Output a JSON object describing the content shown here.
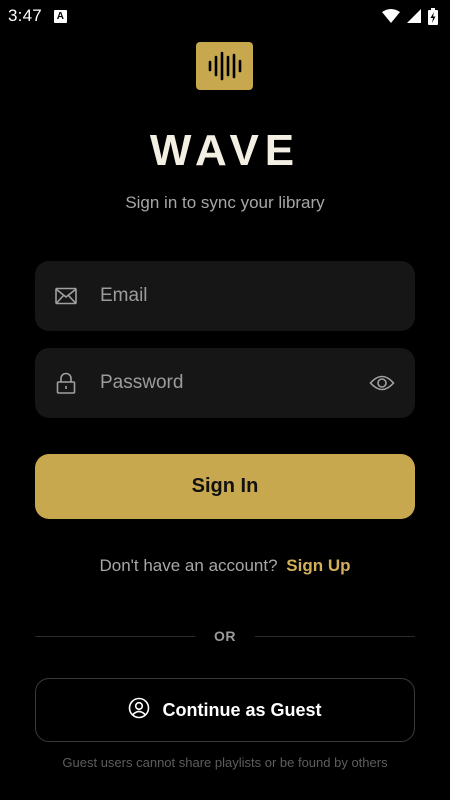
{
  "status_bar": {
    "time": "3:47",
    "notification_letter": "A",
    "icons": [
      "wifi-icon",
      "signal-icon",
      "battery-charging-icon"
    ]
  },
  "brand": {
    "logo_icon": "sound-wave-icon",
    "name": "WAVE",
    "subtitle": "Sign in to sync your library",
    "accent_color": "#c8a84e"
  },
  "form": {
    "email": {
      "placeholder": "Email",
      "value": "",
      "icon": "mail-icon"
    },
    "password": {
      "placeholder": "Password",
      "value": "",
      "icon": "lock-icon",
      "toggle_icon": "eye-icon"
    },
    "sign_in_label": "Sign In"
  },
  "account": {
    "prompt": "Don't have an account?",
    "link": "Sign Up"
  },
  "divider": {
    "label": "OR"
  },
  "guest": {
    "icon": "user-circle-icon",
    "label": "Continue as Guest",
    "note": "Guest users cannot share playlists or be found by others"
  }
}
